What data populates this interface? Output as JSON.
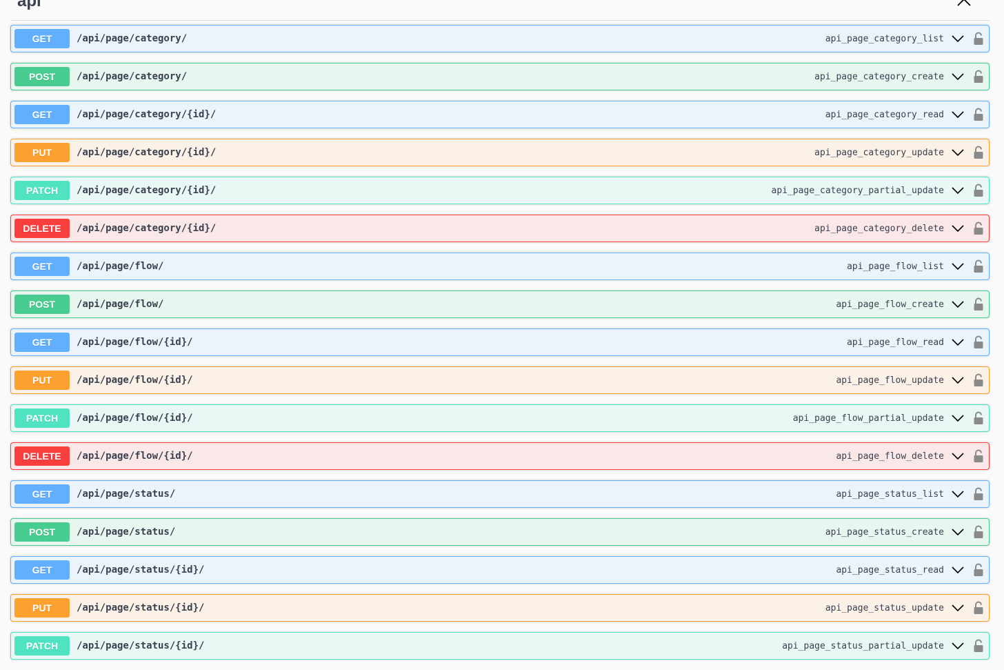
{
  "section": {
    "title": "api"
  },
  "colors": {
    "get": "#61affe",
    "post": "#49cc90",
    "put": "#fca130",
    "patch": "#50e3c2",
    "delete": "#f93e3e",
    "text": "#3b4151"
  },
  "icons": {
    "collapse": "chevron-up-icon",
    "expand": "chevron-down-icon",
    "lock": "unlocked-padlock-icon"
  },
  "operations": [
    {
      "method": "GET",
      "path": "/api/page/category/",
      "operation_id": "api_page_category_list"
    },
    {
      "method": "POST",
      "path": "/api/page/category/",
      "operation_id": "api_page_category_create"
    },
    {
      "method": "GET",
      "path": "/api/page/category/{id}/",
      "operation_id": "api_page_category_read"
    },
    {
      "method": "PUT",
      "path": "/api/page/category/{id}/",
      "operation_id": "api_page_category_update"
    },
    {
      "method": "PATCH",
      "path": "/api/page/category/{id}/",
      "operation_id": "api_page_category_partial_update"
    },
    {
      "method": "DELETE",
      "path": "/api/page/category/{id}/",
      "operation_id": "api_page_category_delete"
    },
    {
      "method": "GET",
      "path": "/api/page/flow/",
      "operation_id": "api_page_flow_list"
    },
    {
      "method": "POST",
      "path": "/api/page/flow/",
      "operation_id": "api_page_flow_create"
    },
    {
      "method": "GET",
      "path": "/api/page/flow/{id}/",
      "operation_id": "api_page_flow_read"
    },
    {
      "method": "PUT",
      "path": "/api/page/flow/{id}/",
      "operation_id": "api_page_flow_update"
    },
    {
      "method": "PATCH",
      "path": "/api/page/flow/{id}/",
      "operation_id": "api_page_flow_partial_update"
    },
    {
      "method": "DELETE",
      "path": "/api/page/flow/{id}/",
      "operation_id": "api_page_flow_delete"
    },
    {
      "method": "GET",
      "path": "/api/page/status/",
      "operation_id": "api_page_status_list"
    },
    {
      "method": "POST",
      "path": "/api/page/status/",
      "operation_id": "api_page_status_create"
    },
    {
      "method": "GET",
      "path": "/api/page/status/{id}/",
      "operation_id": "api_page_status_read"
    },
    {
      "method": "PUT",
      "path": "/api/page/status/{id}/",
      "operation_id": "api_page_status_update"
    },
    {
      "method": "PATCH",
      "path": "/api/page/status/{id}/",
      "operation_id": "api_page_status_partial_update"
    }
  ]
}
